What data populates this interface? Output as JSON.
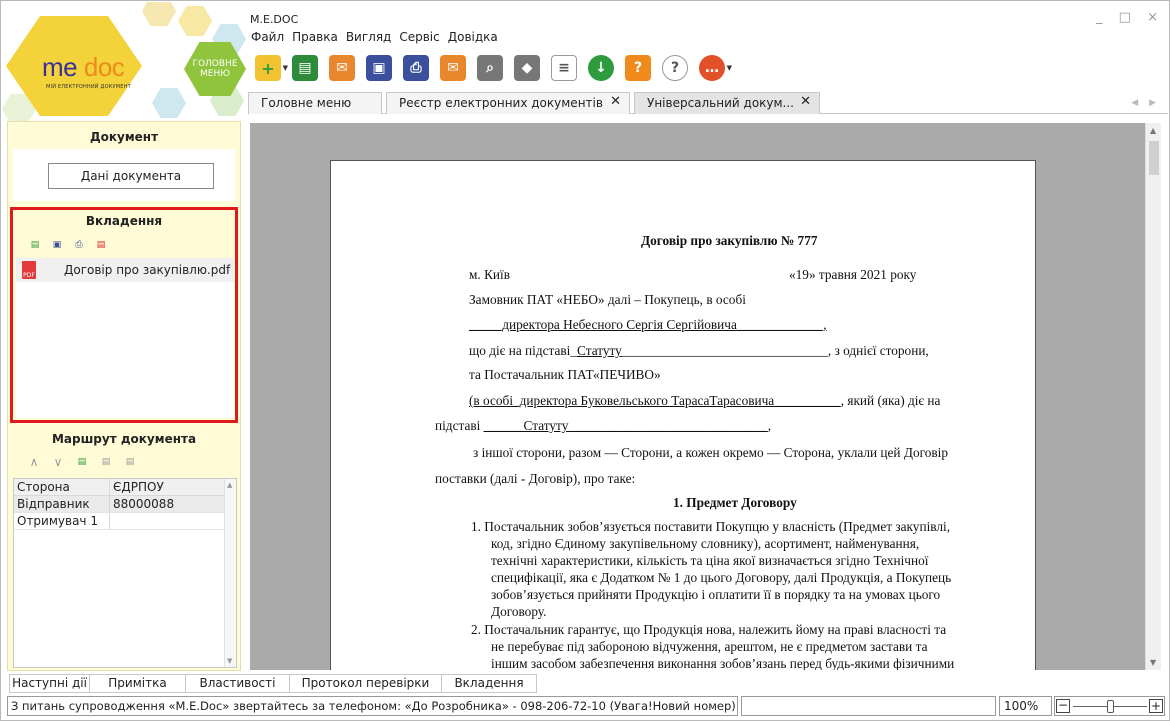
{
  "logo": {
    "brand_me": "me",
    "brand_doc": "doc",
    "tagline": "МІЙ ЕЛЕКТРОННИЙ ДОКУМЕНТ",
    "home_label": "ГОЛОВНЕ МЕНЮ"
  },
  "window": {
    "title": "M.E.DOC",
    "controls": "_ □ ×"
  },
  "menu": [
    "Файл",
    "Правка",
    "Вигляд",
    "Сервіс",
    "Довідка"
  ],
  "toolbar": [
    {
      "icon": "new-document-icon",
      "color": "#f2c230"
    },
    {
      "icon": "copy-document-icon",
      "color": "#2e8b3a"
    },
    {
      "icon": "send-envelope-icon",
      "color": "#e8872b"
    },
    {
      "icon": "archive-icon",
      "color": "#3b4f9c"
    },
    {
      "icon": "print-icon",
      "color": "#3b4f9c"
    },
    {
      "icon": "receive-envelope-icon",
      "color": "#e8872b"
    },
    {
      "icon": "search-icon",
      "color": "#777777"
    },
    {
      "icon": "sign-icon",
      "color": "#777777"
    },
    {
      "icon": "export-icon",
      "color": "#555555"
    },
    {
      "icon": "download-icon",
      "color": "#2e9b3e"
    },
    {
      "icon": "help-icon",
      "color": "#f08a1c"
    },
    {
      "icon": "faq-icon",
      "color": "#666666"
    },
    {
      "icon": "chat-icon",
      "color": "#e2502a"
    }
  ],
  "tabs": [
    {
      "label": "Головне меню",
      "closable": false
    },
    {
      "label": "Реєстр електронних документів",
      "closable": true
    },
    {
      "label": "Універсальний докум...",
      "closable": true,
      "active": true
    }
  ],
  "left": {
    "document_title": "Документ",
    "document_button": "Дані документа",
    "attachments_title": "Вкладення",
    "attachment_file": "Договір про закупівлю.pdf",
    "route_title": "Маршрут документа",
    "route_columns": [
      "Сторона",
      "ЄДРПОУ"
    ],
    "route_rows": [
      {
        "side": "Відправник",
        "code": "88000088"
      },
      {
        "side": "Отримувач 1",
        "code": ""
      }
    ]
  },
  "doc": {
    "title": "Договір про закупівлю № 777",
    "city": "м. Київ",
    "date": "«19» травня 2021 року",
    "l1": "Замовник ПАТ «НЕБО»   далі – Покупець, в особі",
    "l2": "_____директора Небесного Сергія Сергійовича_____________,",
    "l3a": "що діє на підставі_",
    "l3b": "Статуту",
    "l3c": "_______________________________, з однієї сторони,",
    "l4": "та Постачальник ПАТ«ПЕЧИВО»",
    "l5a": "(в особі_директора Буковельського ТарасаТарасовича__________",
    "l5b": ", який (яка) діє на",
    "l6a": "підставі ",
    "l6b": "______Статуту______________________________",
    "l6c": ",",
    "l7": "з іншої сторони, разом — Сторони, а кожен окремо — Сторона,  уклали цей Договір",
    "l8": "поставки (далі - Договір), про таке:",
    "section1": "1. Предмет Договору",
    "item1": [
      "1.  Постачальник зобов’язується поставити Покупцю у власність (Предмет закупівлі,",
      "код, згідно Єдиному закупівельному словнику), асортимент, найменування,",
      "технічні характеристики, кількість та ціна якої визначається згідно Технічної",
      "специфікації, яка є Додатком № 1 до цього Договору, далі Продукція, а Покупець",
      "зобов’язується прийняти Продукцію і оплатити її в порядку та на умовах цього",
      "Договору."
    ],
    "item2": [
      "2. Постачальник гарантує, що Продукція нова, належить йому на праві власності та",
      "не перебуває під забороною відчуження, арештом, не є предметом застави та",
      "іншим засобом забезпечення виконання зобов’язань перед будь-якими фізичними"
    ]
  },
  "bottom_tabs": [
    "Наступні дії",
    "Примітка",
    "Властивості",
    "Протокол перевірки",
    "Вкладення"
  ],
  "status": {
    "message": "З питань супроводження «M.E.Doc» звертайтесь за телефоном: «До Розробника» - 098-206-72-10 (Увага!Новий номер)",
    "zoom": "100%",
    "minus": "−",
    "plus": "+"
  }
}
